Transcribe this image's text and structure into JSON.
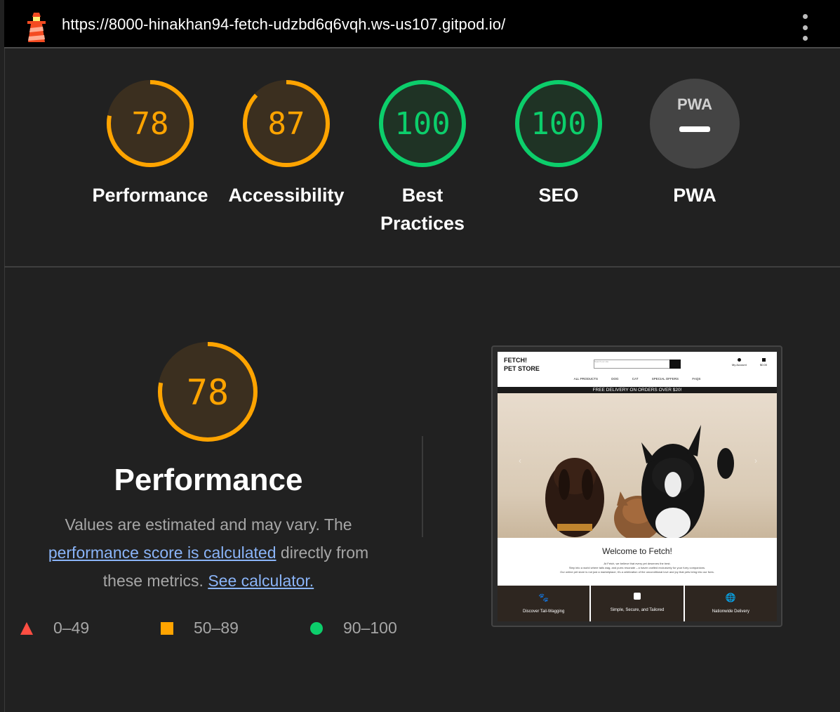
{
  "browser": {
    "url": "https://8000-hinakhan94-fetch-udzbd6q6vqh.ws-us107.gitpod.io/"
  },
  "colors": {
    "orange": "#ffa400",
    "green": "#0cce6b",
    "red": "#ff4e42",
    "pwa_gray": "#444444"
  },
  "scores": [
    {
      "label": "Performance",
      "value": "78",
      "score": 0.78,
      "color": "orange"
    },
    {
      "label": "Accessibility",
      "value": "87",
      "score": 0.87,
      "color": "orange"
    },
    {
      "label": "Best Practices",
      "line1": "Best",
      "line2": "Practices",
      "value": "100",
      "score": 1.0,
      "color": "green"
    },
    {
      "label": "SEO",
      "value": "100",
      "score": 1.0,
      "color": "green"
    },
    {
      "label": "PWA",
      "badge": "PWA",
      "color": "gray"
    }
  ],
  "detail": {
    "score": "78",
    "score_fraction": 0.78,
    "title": "Performance",
    "desc_start": "Values are estimated and may vary. The",
    "link1": "performance score is calculated",
    "desc_mid": "directly from these metrics.",
    "link2": "See calculator."
  },
  "legend": [
    {
      "icon": "triangle-icon",
      "range": "0–49"
    },
    {
      "icon": "square-icon",
      "range": "50–89"
    },
    {
      "icon": "circle-icon",
      "range": "90–100"
    }
  ],
  "screenshot": {
    "logo_line1": "FETCH!",
    "logo_line2": "PET STORE",
    "search_placeholder": "Search our site",
    "account": "My Account",
    "basket": "$0.00",
    "nav": [
      "ALL PRODUCTS",
      "DOG",
      "CAT",
      "SPECIAL OFFERS",
      "FAQS"
    ],
    "banner": "FREE DELIVERY ON ORDERS OVER $20!",
    "welcome": "Welcome to Fetch!",
    "intro1": "At Fetch, we believe that every pet deserves the best.",
    "intro2": "Step into a world where tails wag, and purrs resonate – a haven crafted exclusively for your furry companions.",
    "intro3": "Our online pet store is not just a marketplace; it's a celebration of the unconditional love and joy that pets bring into our lives.",
    "tiles": [
      "Discover Tail-Wagging",
      "Simple, Secure, and Tailored",
      "Nationwide Delivery"
    ]
  }
}
